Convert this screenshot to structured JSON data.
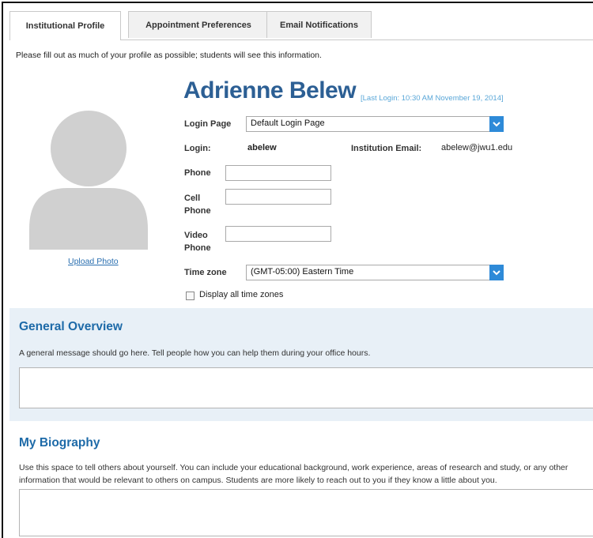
{
  "tabs": [
    {
      "label": "Institutional Profile",
      "active": true
    },
    {
      "label": "Appointment Preferences",
      "active": false
    },
    {
      "label": "Email Notifications",
      "active": false
    }
  ],
  "intro_text": "Please fill out as much of your profile as possible; students will see this information.",
  "profile": {
    "name": "Adrienne Belew",
    "last_login": "[Last Login: 10:30 AM November 19, 2014]",
    "upload_photo_label": "Upload Photo",
    "login_page_label": "Login Page",
    "login_page_value": "Default Login Page",
    "login_label": "Login:",
    "login_value": "abelew",
    "institution_email_label": "Institution Email:",
    "institution_email_value": "abelew@jwu1.edu",
    "phone_label": "Phone",
    "phone_value": "",
    "cell_phone_label_1": "Cell",
    "cell_phone_label_2": "Phone",
    "cell_phone_value": "",
    "video_phone_label_1": "Video",
    "video_phone_label_2": "Phone",
    "video_phone_value": "",
    "time_zone_label": "Time zone",
    "time_zone_value": "(GMT-05:00) Eastern Time",
    "display_all_time_zones_label": "Display all time zones",
    "display_all_time_zones_checked": false
  },
  "general_overview": {
    "title": "General Overview",
    "text": "A general message should go here. Tell people how you can help them during your office hours.",
    "value": ""
  },
  "my_biography": {
    "title": "My Biography",
    "text": "Use this space to tell others about yourself. You can include your educational background, work experience, areas of research and study, or any other information that would be relevant to others on campus. Students are more likely to reach out to you if they know a little about you.",
    "value": ""
  },
  "colors": {
    "accent": "#2c5f94",
    "section_title": "#1d6aa8",
    "panel_bg": "#e8f0f7",
    "dropdown_arrow": "#2e8ad8"
  }
}
